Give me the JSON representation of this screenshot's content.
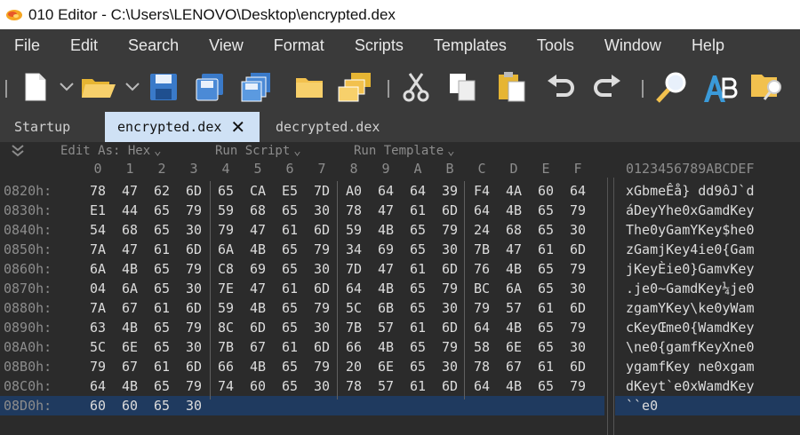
{
  "window": {
    "title": "010 Editor - C:\\Users\\LENOVO\\Desktop\\encrypted.dex"
  },
  "menu": [
    "File",
    "Edit",
    "Search",
    "View",
    "Format",
    "Scripts",
    "Templates",
    "Tools",
    "Window",
    "Help"
  ],
  "tabs": [
    {
      "label": "Startup",
      "active": false
    },
    {
      "label": "encrypted.dex",
      "active": true,
      "close": "✕"
    },
    {
      "label": "decrypted.dex",
      "active": false
    }
  ],
  "options": {
    "edit_as": "Edit As: Hex",
    "run_script": "Run Script",
    "run_template": "Run Template"
  },
  "hex_header": [
    "0",
    "1",
    "2",
    "3",
    "4",
    "5",
    "6",
    "7",
    "8",
    "9",
    "A",
    "B",
    "C",
    "D",
    "E",
    "F"
  ],
  "ascii_header": "0123456789ABCDEF",
  "rows": [
    {
      "addr": "0820h:",
      "bytes": [
        "78",
        "47",
        "62",
        "6D",
        "65",
        "CA",
        "E5",
        "7D",
        "A0",
        "64",
        "64",
        "39",
        "F4",
        "4A",
        "60",
        "64"
      ],
      "ascii": "xGbmeÊå} dd9ôJ`d"
    },
    {
      "addr": "0830h:",
      "bytes": [
        "E1",
        "44",
        "65",
        "79",
        "59",
        "68",
        "65",
        "30",
        "78",
        "47",
        "61",
        "6D",
        "64",
        "4B",
        "65",
        "79"
      ],
      "ascii": "áDeyYhe0xGamdKey"
    },
    {
      "addr": "0840h:",
      "bytes": [
        "54",
        "68",
        "65",
        "30",
        "79",
        "47",
        "61",
        "6D",
        "59",
        "4B",
        "65",
        "79",
        "24",
        "68",
        "65",
        "30"
      ],
      "ascii": "The0yGamYKey$he0"
    },
    {
      "addr": "0850h:",
      "bytes": [
        "7A",
        "47",
        "61",
        "6D",
        "6A",
        "4B",
        "65",
        "79",
        "34",
        "69",
        "65",
        "30",
        "7B",
        "47",
        "61",
        "6D"
      ],
      "ascii": "zGamjKey4ie0{Gam"
    },
    {
      "addr": "0860h:",
      "bytes": [
        "6A",
        "4B",
        "65",
        "79",
        "C8",
        "69",
        "65",
        "30",
        "7D",
        "47",
        "61",
        "6D",
        "76",
        "4B",
        "65",
        "79"
      ],
      "ascii": "jKeyÈie0}GamvKey"
    },
    {
      "addr": "0870h:",
      "bytes": [
        "04",
        "6A",
        "65",
        "30",
        "7E",
        "47",
        "61",
        "6D",
        "64",
        "4B",
        "65",
        "79",
        "BC",
        "6A",
        "65",
        "30"
      ],
      "ascii": ".je0~GamdKey¼je0"
    },
    {
      "addr": "0880h:",
      "bytes": [
        "7A",
        "67",
        "61",
        "6D",
        "59",
        "4B",
        "65",
        "79",
        "5C",
        "6B",
        "65",
        "30",
        "79",
        "57",
        "61",
        "6D"
      ],
      "ascii": "zgamYKey\\ke0yWam"
    },
    {
      "addr": "0890h:",
      "bytes": [
        "63",
        "4B",
        "65",
        "79",
        "8C",
        "6D",
        "65",
        "30",
        "7B",
        "57",
        "61",
        "6D",
        "64",
        "4B",
        "65",
        "79"
      ],
      "ascii": "cKeyŒme0{WamdKey"
    },
    {
      "addr": "08A0h:",
      "bytes": [
        "5C",
        "6E",
        "65",
        "30",
        "7B",
        "67",
        "61",
        "6D",
        "66",
        "4B",
        "65",
        "79",
        "58",
        "6E",
        "65",
        "30"
      ],
      "ascii": "\\ne0{gamfKeyXne0"
    },
    {
      "addr": "08B0h:",
      "bytes": [
        "79",
        "67",
        "61",
        "6D",
        "66",
        "4B",
        "65",
        "79",
        "20",
        "6E",
        "65",
        "30",
        "78",
        "67",
        "61",
        "6D"
      ],
      "ascii": "ygamfKey ne0xgam"
    },
    {
      "addr": "08C0h:",
      "bytes": [
        "64",
        "4B",
        "65",
        "79",
        "74",
        "60",
        "65",
        "30",
        "78",
        "57",
        "61",
        "6D",
        "64",
        "4B",
        "65",
        "79"
      ],
      "ascii": "dKeyt`e0xWamdKey"
    },
    {
      "addr": "08D0h:",
      "bytes": [
        "60",
        "60",
        "65",
        "30"
      ],
      "ascii": "``e0",
      "current": true
    }
  ],
  "icons": [
    "new-file-icon",
    "open-folder-icon",
    "save-icon",
    "save-as-icon",
    "save-all-icon",
    "folder-icon",
    "folders-icon",
    "cut-icon",
    "copy-icon",
    "paste-icon",
    "undo-icon",
    "redo-icon",
    "find-icon",
    "replace-icon",
    "find-in-files-icon"
  ]
}
